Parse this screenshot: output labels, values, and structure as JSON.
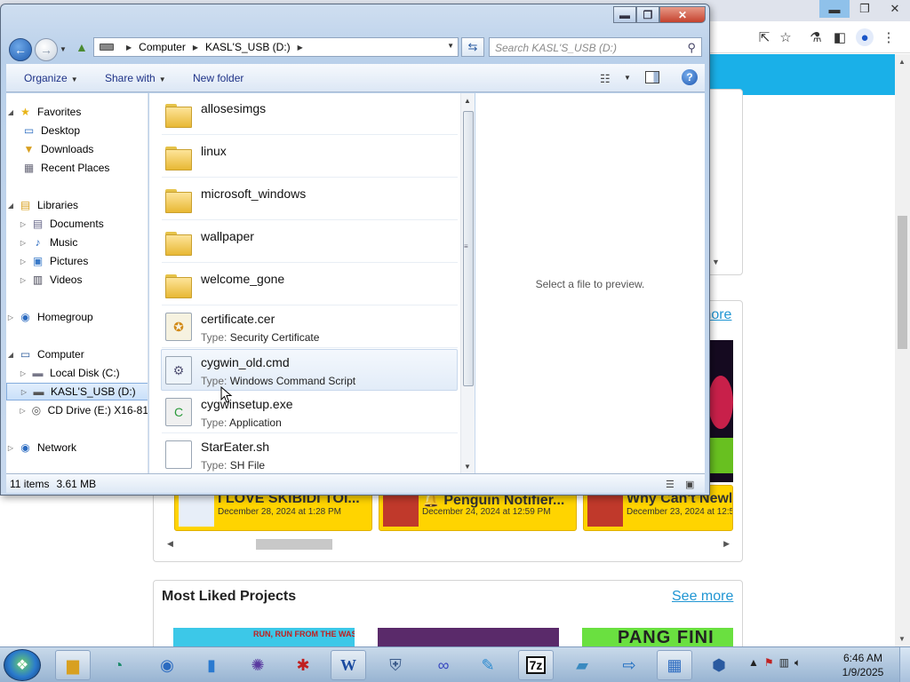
{
  "browser": {
    "window_buttons": {
      "minimize": "▬",
      "restore": "❐",
      "close": "✕"
    },
    "see_more_1": "more",
    "projects": [
      {
        "title": "I LOVE SKIBIDI TOI...",
        "date": "December 28, 2024 at 1:28 PM"
      },
      {
        "title": "🔔 Penguin Notifier...",
        "date": "December 24, 2024 at 12:59 PM"
      },
      {
        "title": "Why Can't Newl",
        "date": "December 23, 2024 at 12:5"
      }
    ],
    "most_liked_title": "Most Liked Projects",
    "see_more_2": "See more",
    "liked_thumb_text_1": "RUN, RUN FROM THE WASPS!",
    "liked_thumb_text_3": "PANG FINI"
  },
  "explorer": {
    "breadcrumb": [
      "Computer",
      "KASL'S_USB (D:)"
    ],
    "search_placeholder": "Search KASL'S_USB (D:)",
    "commands": {
      "organize": "Organize",
      "share_with": "Share with",
      "new_folder": "New folder"
    },
    "nav": {
      "favorites": "Favorites",
      "desktop": "Desktop",
      "downloads": "Downloads",
      "recent_places": "Recent Places",
      "libraries": "Libraries",
      "documents": "Documents",
      "music": "Music",
      "pictures": "Pictures",
      "videos": "Videos",
      "homegroup": "Homegroup",
      "computer": "Computer",
      "local_disk": "Local Disk (C:)",
      "usb": "KASL'S_USB (D:)",
      "cd_drive": "CD Drive (E:) X16-81",
      "network": "Network"
    },
    "type_label": "Type:",
    "files": [
      {
        "name": "allosesimgs",
        "kind": "folder"
      },
      {
        "name": "linux",
        "kind": "folder"
      },
      {
        "name": "microsoft_windows",
        "kind": "folder"
      },
      {
        "name": "wallpaper",
        "kind": "folder"
      },
      {
        "name": "welcome_gone",
        "kind": "folder"
      },
      {
        "name": "certificate.cer",
        "type": "Security Certificate",
        "kind": "cert"
      },
      {
        "name": "cygwin_old.cmd",
        "type": "Windows Command Script",
        "kind": "cmd"
      },
      {
        "name": "cygwinsetup.exe",
        "type": "Application",
        "kind": "exe"
      },
      {
        "name": "StarEater.sh",
        "type": "SH File",
        "kind": "sh"
      }
    ],
    "preview_message": "Select a file to preview.",
    "status": {
      "items": "11 items",
      "size": "3.61 MB"
    }
  },
  "taskbar": {
    "time": "6:46 AM",
    "date": "1/9/2025",
    "apps": [
      "explorer",
      "chrome-like",
      "network-globe",
      "usb-drive",
      "game-ball",
      "spider-game",
      "word",
      "security",
      "infinity-app",
      "paint",
      "7zip",
      "notepad",
      "remote-desktop",
      "control-panel",
      "virtualbox"
    ],
    "word_label": "W",
    "sevenzip_label": "7z"
  },
  "colors": {
    "accent": "#1ab0e8",
    "link": "#2196d3",
    "project_bg": "#ffd400"
  }
}
